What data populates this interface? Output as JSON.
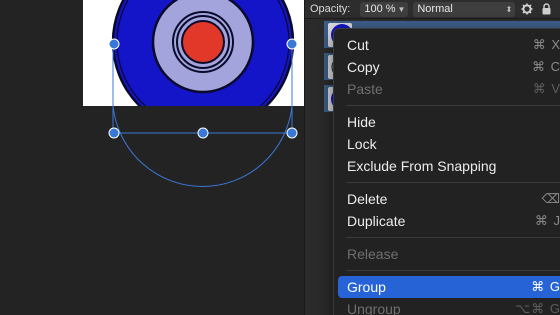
{
  "toolbar": {
    "opacity_label": "Opacity:",
    "opacity_value": "100 %",
    "blend_mode": "Normal",
    "settings_icon": "gear-icon",
    "lock_icon": "lock-icon"
  },
  "context_menu": {
    "items": [
      {
        "label": "Cut",
        "shortcut": "⌘ X",
        "disabled": false
      },
      {
        "label": "Copy",
        "shortcut": "⌘ C",
        "disabled": false
      },
      {
        "label": "Paste",
        "shortcut": "⌘ V",
        "disabled": true
      },
      {
        "label": "Hide",
        "shortcut": "",
        "disabled": false
      },
      {
        "label": "Lock",
        "shortcut": "",
        "disabled": false
      },
      {
        "label": "Exclude From Snapping",
        "shortcut": "",
        "disabled": false
      },
      {
        "label": "Delete",
        "shortcut": "⌫",
        "disabled": false
      },
      {
        "label": "Duplicate",
        "shortcut": "⌘ J",
        "disabled": false
      },
      {
        "label": "Release",
        "shortcut": "",
        "disabled": true
      },
      {
        "label": "Group",
        "shortcut": "⌘ G",
        "disabled": false,
        "highlighted": true
      },
      {
        "label": "Ungroup",
        "shortcut": "⌥⌘ G",
        "disabled": true
      }
    ]
  },
  "colors": {
    "accent": "#2563d6",
    "target_outer": "#1414c8",
    "target_ring": "#a4a4dc",
    "target_center": "#e2382a",
    "selection": "#3a78d8"
  }
}
